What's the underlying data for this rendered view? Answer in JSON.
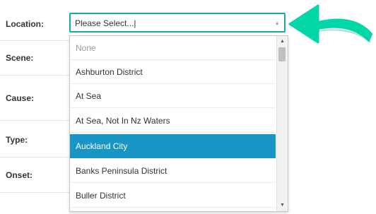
{
  "form": {
    "labels": [
      "Location:",
      "Scene:",
      "Cause:",
      "Type:",
      "Onset:"
    ]
  },
  "location_select": {
    "value": "Please Select...|",
    "caret": "▲"
  },
  "dropdown": {
    "options": [
      {
        "label": "None",
        "state": "muted"
      },
      {
        "label": "Ashburton District",
        "state": "normal"
      },
      {
        "label": "At Sea",
        "state": "normal"
      },
      {
        "label": "At Sea, Not In Nz Waters",
        "state": "normal"
      },
      {
        "label": "Auckland City",
        "state": "selected"
      },
      {
        "label": "Banks Peninsula District",
        "state": "normal"
      },
      {
        "label": "Buller District",
        "state": "normal"
      }
    ],
    "scroll_up": "▲",
    "scroll_down": "▼"
  },
  "colors": {
    "accent": "#16a6bd",
    "selected_bg": "#1795c5",
    "arrow": "#00d6a6"
  },
  "icons": {
    "pointer": "curved-arrow-icon",
    "caret": "caret-up-icon"
  }
}
